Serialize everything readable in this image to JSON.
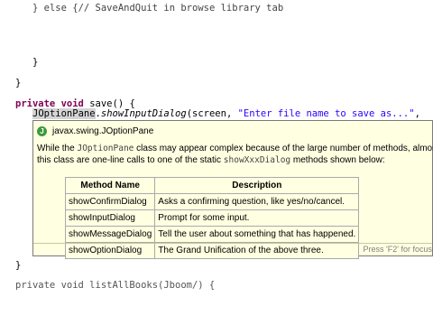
{
  "editor": {
    "line1": "} else {// SaveAndQuit in browse library tab",
    "line2": "}",
    "line3": "}",
    "line4_kw1": "private",
    "line4_kw2": "void",
    "line4_rest": "save() {",
    "line5_class": "JOptionPane",
    "line5_dot": ".",
    "line5_method": "showInputDialog",
    "line5_args": "(screen, ",
    "line5_str": "\"Enter file name to save as...\"",
    "line5_end": ",",
    "line7": "}",
    "line8": "private void listAllBooks(Jboom/) {"
  },
  "tooltip": {
    "icon_text": "J",
    "title": "javax.swing.JOptionPane",
    "body_1": "While the ",
    "body_code1": "JOptionPane",
    "body_2": " class may appear complex because of the large number of methods, almost all uses of",
    "body_3": "this class are one-line calls to one of the static ",
    "body_code2": "showXxxDialog",
    "body_4": " methods shown below:",
    "table": {
      "headers": [
        "Method Name",
        "Description"
      ],
      "rows": [
        [
          "showConfirmDialog",
          "Asks a confirming question, like yes/no/cancel."
        ],
        [
          "showInputDialog",
          "Prompt for some input."
        ],
        [
          "showMessageDialog",
          "Tell the user about something that has happened."
        ],
        [
          "showOptionDialog",
          "The Grand Unification of the above three."
        ]
      ]
    },
    "footer_hint": "Press 'F2' for focus"
  }
}
